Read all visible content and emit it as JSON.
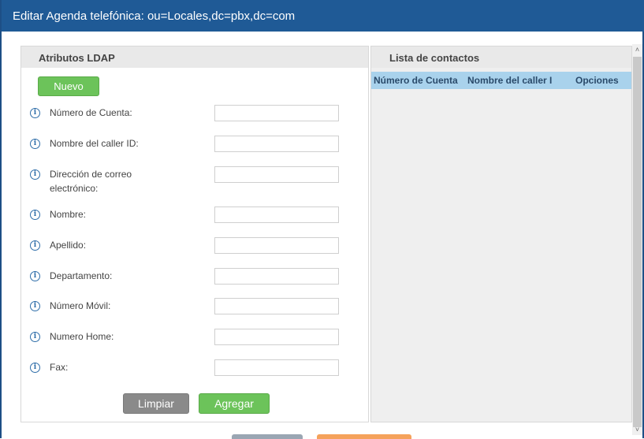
{
  "title": "Editar Agenda telefónica: ou=Locales,dc=pbx,dc=com",
  "left_panel": {
    "header": "Atributos LDAP",
    "new_button": "Nuevo",
    "fields": [
      {
        "label": "Número de Cuenta:",
        "value": ""
      },
      {
        "label": "Nombre del caller ID:",
        "value": ""
      },
      {
        "label": "Dirección de correo electrónico:",
        "value": ""
      },
      {
        "label": "Nombre:",
        "value": ""
      },
      {
        "label": "Apellido:",
        "value": ""
      },
      {
        "label": "Departamento:",
        "value": ""
      },
      {
        "label": "Número Móvil:",
        "value": ""
      },
      {
        "label": "Numero Home:",
        "value": ""
      },
      {
        "label": "Fax:",
        "value": ""
      }
    ],
    "clear_button": "Limpiar",
    "add_button": "Agregar"
  },
  "right_panel": {
    "header": "Lista de contactos",
    "columns": [
      "Número de Cuenta",
      "Nombre del caller I",
      "Opciones"
    ]
  },
  "info_icon_glyph": "i",
  "colors": {
    "title_bar": "#1f5a96",
    "green_button": "#6cc35a",
    "gray_button": "#8a8a8a",
    "table_header": "#a9d2ec"
  }
}
